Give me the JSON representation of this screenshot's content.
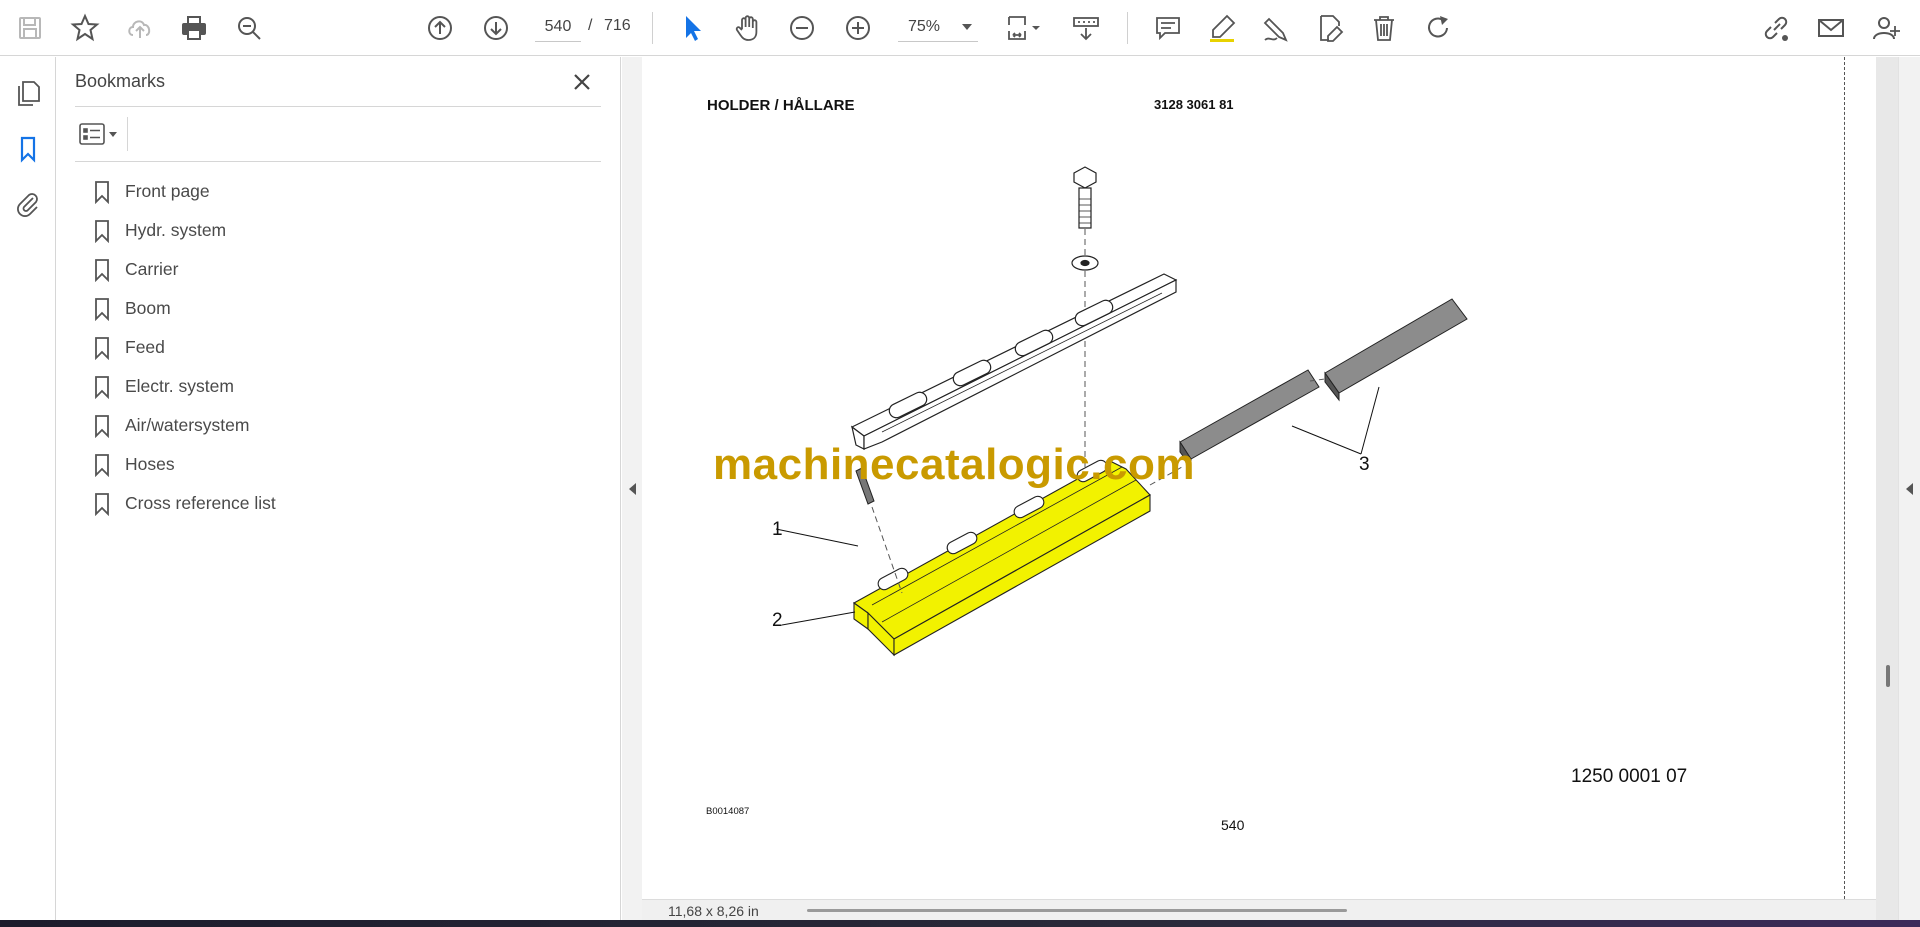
{
  "toolbar": {
    "current_page": "540",
    "page_separator": "/",
    "total_pages": "716",
    "zoom": "75%",
    "icons": [
      "save-icon",
      "star-icon",
      "cloud-upload-icon",
      "print-icon",
      "zoom-search-icon",
      "page-up-icon",
      "page-down-icon",
      "cursor-icon",
      "hand-icon",
      "zoom-out-icon",
      "zoom-in-icon",
      "fit-page-icon",
      "scroll-mode-icon",
      "comment-icon",
      "highlight-icon",
      "draw-icon",
      "fill-sign-icon",
      "delete-icon",
      "rotate-icon",
      "share-link-icon",
      "email-icon",
      "account-icon"
    ]
  },
  "sidebar": {
    "title": "Bookmarks",
    "items": [
      {
        "label": "Front page"
      },
      {
        "label": "Hydr. system"
      },
      {
        "label": "Carrier"
      },
      {
        "label": "Boom"
      },
      {
        "label": "Feed"
      },
      {
        "label": "Electr. system"
      },
      {
        "label": "Air/watersystem"
      },
      {
        "label": "Hoses"
      },
      {
        "label": "Cross reference list"
      }
    ]
  },
  "document": {
    "title": "HOLDER / HÅLLARE",
    "part_number": "3128 3061 81",
    "reference_number": "1250 0001 07",
    "drawing_code": "B0014087",
    "page_number": "540",
    "watermark": "machinecatalogic.com",
    "callouts": [
      "1",
      "2",
      "3"
    ]
  },
  "status": {
    "page_dimensions": "11,68 x 8,26 in"
  },
  "colors": {
    "highlight_yellow": "#f2f200",
    "watermark_gold": "#c99a00",
    "accent_blue": "#1473e6"
  }
}
